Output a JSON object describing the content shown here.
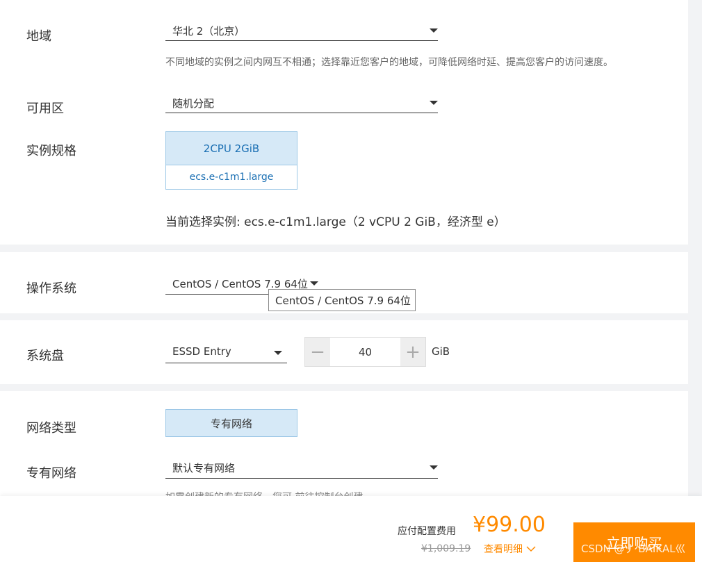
{
  "region": {
    "label": "地域",
    "value": "华北 2（北京）",
    "hint": "不同地域的实例之间内网互不相通；选择靠近您客户的地域，可降低网络时延、提高您客户的访问速度。"
  },
  "zone": {
    "label": "可用区",
    "value": "随机分配"
  },
  "instance_spec": {
    "label": "实例规格",
    "card_top": "2CPU 2GiB",
    "card_bottom": "ecs.e-c1m1.large",
    "current": "当前选择实例: ecs.e-c1m1.large（2 vCPU 2 GiB，经济型 e）"
  },
  "os": {
    "label": "操作系统",
    "value": "CentOS / CentOS 7.9 64位",
    "tooltip": "CentOS / CentOS  7.9 64位"
  },
  "system_disk": {
    "label": "系统盘",
    "type": "ESSD Entry",
    "size": "40",
    "unit": "GiB",
    "minus": "−",
    "plus": "+"
  },
  "network_type": {
    "label": "网络类型",
    "value": "专有网络"
  },
  "vpc": {
    "label": "专有网络",
    "value": "默认专有网络",
    "hint_partial": "如需创建新的专有网络，您可 前往控制台创建"
  },
  "footer": {
    "fee_label": "应付配置费用",
    "price": "¥99.00",
    "original_price": "¥1,009.19",
    "details_link": "查看明细",
    "buy_button": "立即购买",
    "watermark": "CSDN @丿 BAIKAL巛"
  },
  "colors": {
    "accent_orange": "#ff8a00",
    "selected_bg": "#d6e9f7",
    "link_blue": "#1a6fb3"
  }
}
